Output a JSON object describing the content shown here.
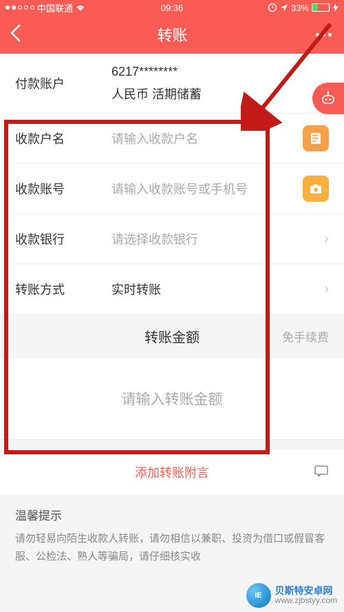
{
  "status": {
    "carrier": "中国联通",
    "time": "09:36",
    "battery_pct": "33%"
  },
  "nav": {
    "title": "转账"
  },
  "payer": {
    "label": "付款账户",
    "account": "6217********",
    "sub": "人民币 活期储蓄"
  },
  "rows": {
    "payee_name": {
      "label": "收款户名",
      "placeholder": "请输入收款户名"
    },
    "payee_acct": {
      "label": "收款账号",
      "placeholder": "请输入收款账号或手机号"
    },
    "payee_bank": {
      "label": "收款银行",
      "placeholder": "请选择收款银行"
    },
    "method": {
      "label": "转账方式",
      "value": "实时转账"
    }
  },
  "amount": {
    "title": "转账金额",
    "fee": "免手续费",
    "placeholder": "请输入转账金额"
  },
  "note": {
    "add": "添加转账附言"
  },
  "tip": {
    "title": "温馨提示",
    "body": "请勿轻易向陌生收款人转账，请勿相信以兼职、投资为借口或假冒客服、公检法、熟人等骗局，请仔细核实收"
  },
  "icons": {
    "robot": "robot-icon",
    "contacts": "contacts-icon",
    "camera": "camera-icon",
    "message": "message-icon"
  },
  "watermark": {
    "line1": "贝斯特安卓网",
    "line2": "www.zjbstyy.com"
  }
}
